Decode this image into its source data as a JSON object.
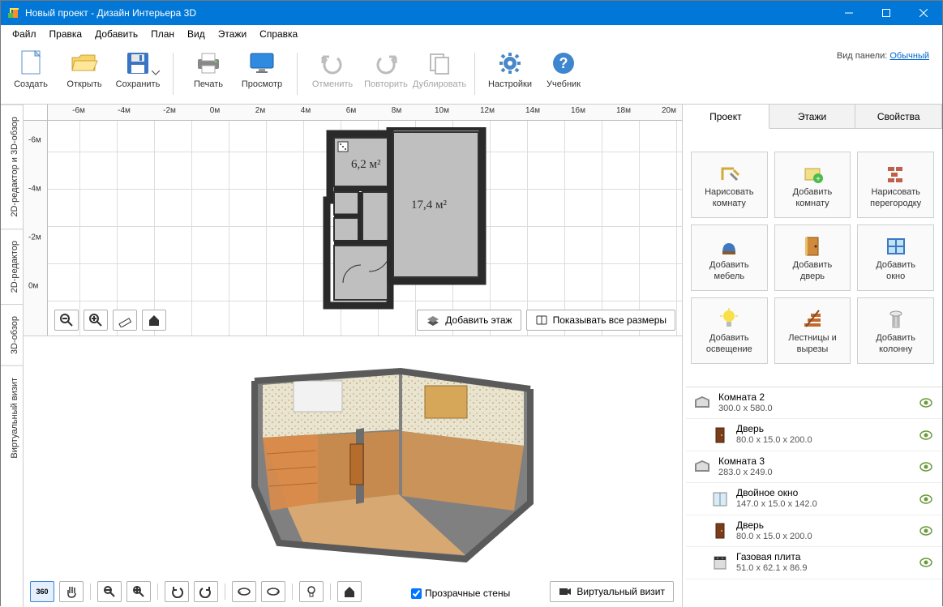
{
  "window": {
    "title": "Новый проект - Дизайн Интерьера 3D"
  },
  "menu": [
    "Файл",
    "Правка",
    "Добавить",
    "План",
    "Вид",
    "Этажи",
    "Справка"
  ],
  "toolbar": {
    "create": "Создать",
    "open": "Открыть",
    "save": "Сохранить",
    "print": "Печать",
    "preview": "Просмотр",
    "undo": "Отменить",
    "redo": "Повторить",
    "duplicate": "Дублировать",
    "settings": "Настройки",
    "tutorial": "Учебник",
    "panel_label": "Вид панели:",
    "panel_mode": "Обычный"
  },
  "vtabs": {
    "both": "2D-редактор и 3D-обзор",
    "editor2d": "2D-редактор",
    "view3d": "3D-обзор",
    "virtual": "Виртуальный визит"
  },
  "ruler_x": [
    "-6м",
    "-4м",
    "-2м",
    "0м",
    "2м",
    "4м",
    "6м",
    "8м",
    "10м",
    "12м",
    "14м",
    "16м",
    "18м",
    "20м"
  ],
  "ruler_y": [
    "-6м",
    "-4м",
    "-2м",
    "0м"
  ],
  "plan": {
    "room1_label": "6,2 м²",
    "room2_label": "17,4 м²"
  },
  "toolstrip2d": {
    "add_floor": "Добавить этаж",
    "show_dims": "Показывать все размеры"
  },
  "threeD": {
    "transparent_walls": "Прозрачные стены",
    "virtual_visit": "Виртуальный визит"
  },
  "right_tabs": [
    "Проект",
    "Этажи",
    "Свойства"
  ],
  "actions": [
    [
      "Нарисовать",
      "комнату"
    ],
    [
      "Добавить",
      "комнату"
    ],
    [
      "Нарисовать",
      "перегородку"
    ],
    [
      "Добавить",
      "мебель"
    ],
    [
      "Добавить",
      "дверь"
    ],
    [
      "Добавить",
      "окно"
    ],
    [
      "Добавить",
      "освещение"
    ],
    [
      "Лестницы и",
      "вырезы"
    ],
    [
      "Добавить",
      "колонну"
    ]
  ],
  "objects": [
    {
      "name": "Комната 2",
      "dims": "300.0 x 580.0",
      "type": "room"
    },
    {
      "name": "Дверь",
      "dims": "80.0 x 15.0 x 200.0",
      "type": "door",
      "child": true
    },
    {
      "name": "Комната 3",
      "dims": "283.0 x 249.0",
      "type": "room"
    },
    {
      "name": "Двойное окно",
      "dims": "147.0 x 15.0 x 142.0",
      "type": "window",
      "child": true
    },
    {
      "name": "Дверь",
      "dims": "80.0 x 15.0 x 200.0",
      "type": "door",
      "child": true
    },
    {
      "name": "Газовая плита",
      "dims": "51.0 x 62.1 x 86.9",
      "type": "stove",
      "child": true
    }
  ]
}
